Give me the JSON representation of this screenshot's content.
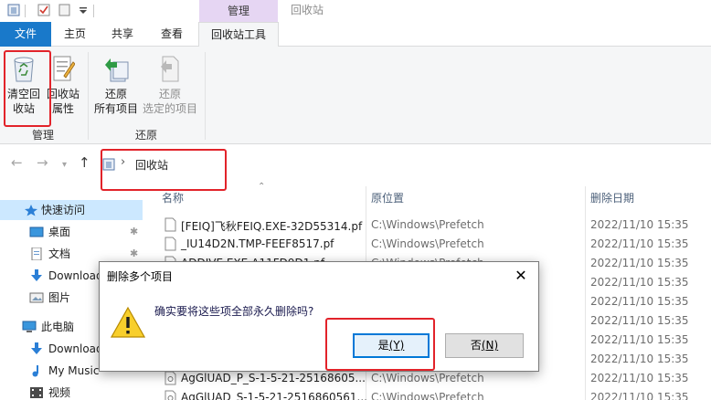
{
  "titlebar": {
    "context_tab": "管理",
    "window_title": "回收站"
  },
  "tabs": [
    {
      "label": "文件"
    },
    {
      "label": "主页"
    },
    {
      "label": "共享"
    },
    {
      "label": "查看"
    },
    {
      "label": "回收站工具"
    }
  ],
  "ribbon": {
    "manage_group": {
      "label": "管理",
      "empty_line1": "清空回",
      "empty_line2": "收站",
      "props_line1": "回收站",
      "props_line2": "属性"
    },
    "restore_group": {
      "label": "还原",
      "restore_all_line1": "还原",
      "restore_all_line2": "所有项目",
      "restore_sel_line1": "还原",
      "restore_sel_line2": "选定的项目"
    }
  },
  "address": {
    "path": "回收站"
  },
  "sidebar": {
    "items": [
      {
        "label": "快速访问"
      },
      {
        "label": "桌面"
      },
      {
        "label": "文档"
      },
      {
        "label": "Downloads"
      },
      {
        "label": "图片"
      },
      {
        "label": "此电脑"
      },
      {
        "label": "Downloads"
      },
      {
        "label": "My Music"
      },
      {
        "label": "视频"
      }
    ]
  },
  "columns": {
    "name": "名称",
    "location": "原位置",
    "date": "删除日期"
  },
  "files": [
    {
      "name": "[FEIQ]飞秋FEIQ.EXE-32D55314.pf",
      "location": "C:\\Windows\\Prefetch",
      "date": "2022/11/10 15:35"
    },
    {
      "name": "_IU14D2N.TMP-FEEF8517.pf",
      "location": "C:\\Windows\\Prefetch",
      "date": "2022/11/10 15:35"
    },
    {
      "name": "ADDIVE.EXE-A11FD9D1.pf",
      "location": "C:\\Windows\\Prefetch",
      "date": "2022/11/10 15:35"
    },
    {
      "name": "",
      "location": "",
      "date": "2022/11/10 15:35"
    },
    {
      "name": "",
      "location": "",
      "date": "2022/11/10 15:35"
    },
    {
      "name": "",
      "location": "",
      "date": "2022/11/10 15:35"
    },
    {
      "name": "",
      "location": "",
      "date": "2022/11/10 15:35"
    },
    {
      "name": "",
      "location": "",
      "date": "2022/11/10 15:35"
    },
    {
      "name": "AgGlUAD_P_S-1-5-21-25168605...",
      "location": "C:\\Windows\\Prefetch",
      "date": "2022/11/10 15:35"
    },
    {
      "name": "AgGlUAD_S-1-5-21-2516860561...",
      "location": "C:\\Windows\\Prefetch",
      "date": "2022/11/10 15:35"
    }
  ],
  "dialog": {
    "title": "删除多个项目",
    "message": "确实要将这些项全部永久删除吗?",
    "yes_label": "是",
    "yes_key": "(Y)",
    "no_label": "否",
    "no_key": "(N)"
  },
  "colors": {
    "accent": "#1979ca",
    "context_tab": "#e6d6f3",
    "highlight": "#e2232a",
    "selection": "#cce8ff"
  }
}
